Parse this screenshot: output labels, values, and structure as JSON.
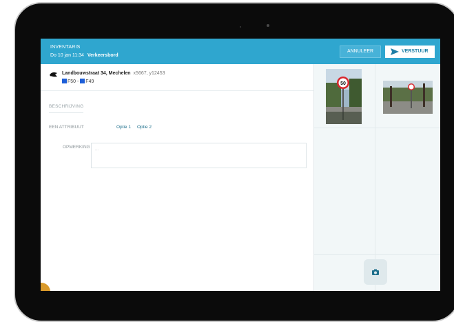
{
  "header": {
    "title": "INVENTARIS",
    "date": "Do 10 jan 11:34",
    "type": "Verkeersbord",
    "cancel_label": "ANNULEER",
    "send_label": "VERSTUUR"
  },
  "location": {
    "address": "Landbouwstraat 34, Mechelen",
    "coords": "x5667, y12453",
    "sign1": "F50",
    "separator": " - ",
    "sign2": "F49"
  },
  "form": {
    "description_tab": "BESCHRIJVING",
    "attribute_label": "EEN ATTRIBUUT",
    "option1": "Optie 1",
    "option2": "Optie 2",
    "remark_label": "OPMERKING",
    "remark_placeholder": "..."
  },
  "colors": {
    "header_bg": "#2fa6cf",
    "accent_text": "#1d6f8c",
    "sign_icon": "#1e5fd8"
  },
  "icons": {
    "send": "send-icon",
    "location": "location-pin-icon",
    "camera": "camera-icon"
  }
}
